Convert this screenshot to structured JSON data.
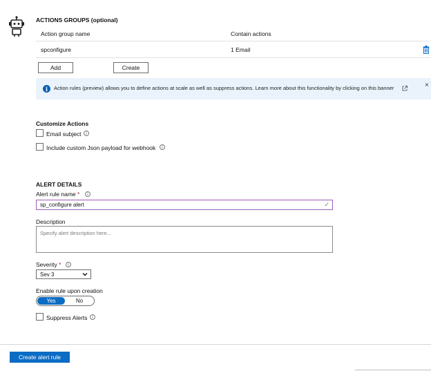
{
  "actions_groups": {
    "title": "ACTIONS GROUPS (optional)",
    "columns": [
      "Action group name",
      "Contain actions"
    ],
    "rows": [
      {
        "name": "spconfigure",
        "actions": "1 Email"
      }
    ],
    "add_label": "Add",
    "create_label": "Create"
  },
  "banner": {
    "text": "Action rules (preview) allows you to define actions at scale as well as suppress actions. Learn more about this functionality by clicking on this banner",
    "close": "×"
  },
  "customize": {
    "title": "Customize Actions",
    "email_subject": "Email subject",
    "json_payload": "Include custom Json payload for webhook"
  },
  "alert_details": {
    "title": "ALERT DETAILS",
    "rule_name_label": "Alert rule name",
    "required_mark": "*",
    "rule_name_value": "sp_configure alert",
    "description_label": "Description",
    "description_placeholder": "Specify alert description here...",
    "severity_label": "Severity",
    "severity_value": "Sev 3",
    "enable_label": "Enable rule upon creation",
    "toggle_yes": "Yes",
    "toggle_no": "No",
    "suppress_label": "Suppress Alerts"
  },
  "footer": {
    "create_button": "Create alert rule"
  },
  "colors": {
    "primary": "#0b6cc4",
    "banner_bg": "#eaf3fb",
    "required": "#a4262c",
    "focus_border": "#9d5cb8",
    "valid_check": "#5a9c41"
  }
}
